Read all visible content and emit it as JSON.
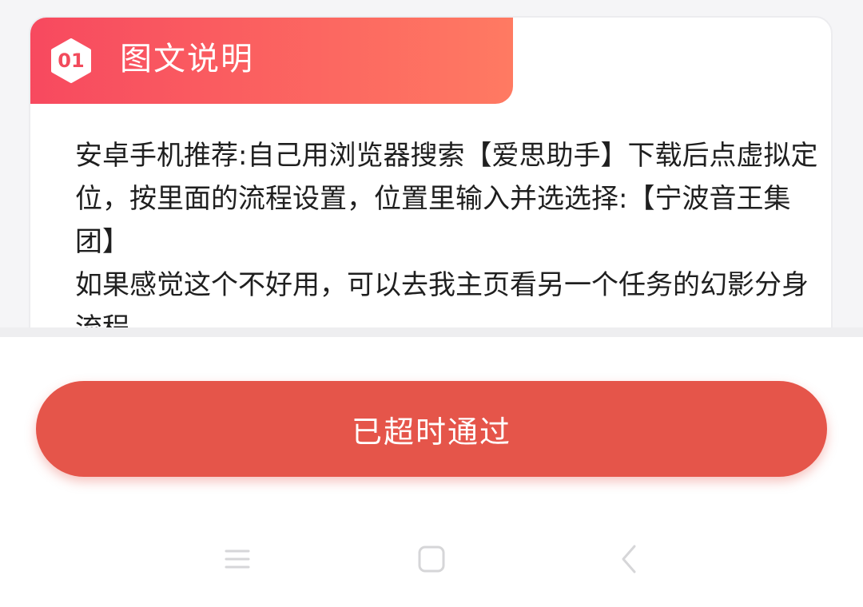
{
  "card": {
    "step_number": "01",
    "title": "图文说明",
    "body": [
      "安卓手机推荐:自己用浏览器搜索【爱思助手】下载后点虚拟定位，按里面的流程设置，位置里输入并选选择:【宁波音王集团】",
      "如果感觉这个不好用，可以去我主页看另一个任务的幻影分身流程"
    ]
  },
  "action_button": {
    "label": "已超时通过"
  },
  "colors": {
    "header_gradient_start": "#f7495f",
    "header_gradient_end": "#ff7a62",
    "button": "#e5554a",
    "text": "#1f1f1f"
  },
  "nav": {
    "menu_icon": "menu-icon",
    "home_icon": "home-icon",
    "back_icon": "back-icon"
  }
}
